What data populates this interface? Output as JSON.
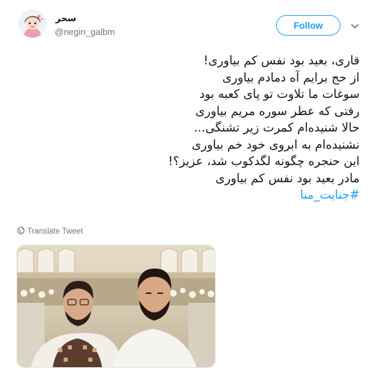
{
  "user": {
    "display_name": "سحر",
    "handle": "@negin_galbm"
  },
  "actions": {
    "follow_label": "Follow",
    "more_icon": "chevron-down-icon"
  },
  "tweet": {
    "lines": [
      "قاری، بعید بود نفس کم بیاوری!",
      "از حج برایم آه دمادم بیاوری",
      "سوغات ما تلاوت تو پای کعبه بود",
      "رفتی که عطر سوره مریم بیاوری",
      "حالا شنیده‌ام کمرت زیر تشنگی...",
      "نشنیده‌ام به ابروی خود خم بیاوری",
      "این حنجره چگونه لگدکوب شد، عزیز؟!",
      "مادر بعید بود نفس کم بیاوری"
    ],
    "hashtag": "#جنایت_منا"
  },
  "translate_label": "Translate Tweet",
  "colors": {
    "accent": "#1da1f2",
    "text": "#14171a",
    "secondary": "#657786"
  }
}
